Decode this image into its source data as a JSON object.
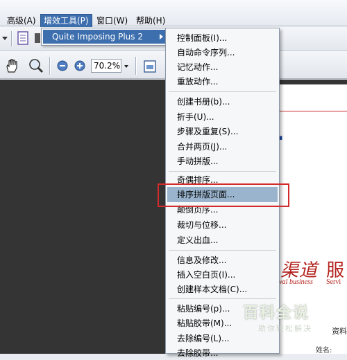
{
  "menubar": {
    "items": [
      {
        "label": "高级(A)"
      },
      {
        "label": "增效工具(P)"
      },
      {
        "label": "窗口(W)"
      },
      {
        "label": "帮助(H)"
      }
    ]
  },
  "toolbar": {
    "zoom_value": "70.2%"
  },
  "submenu1": {
    "label": "Quite Imposing Plus 2"
  },
  "submenu2": {
    "items": [
      {
        "label": "控制面板(I)..."
      },
      {
        "label": "自动命令序列..."
      },
      {
        "label": "记忆动作..."
      },
      {
        "label": "重放动作..."
      },
      {
        "label": "创建书册(b)..."
      },
      {
        "label": "折手(U)..."
      },
      {
        "label": "步骤及重复(S)..."
      },
      {
        "label": "合并两页(J)..."
      },
      {
        "label": "手动拼版..."
      },
      {
        "label": "奇偶排序..."
      },
      {
        "label": "排序拼版页面..."
      },
      {
        "label": "颠倒页序..."
      },
      {
        "label": "裁切与位移..."
      },
      {
        "label": "定义出血..."
      },
      {
        "label": "信息及修改..."
      },
      {
        "label": "插入空白页(I)..."
      },
      {
        "label": "创建样本文档(C)..."
      },
      {
        "label": "粘贴编号(p)..."
      },
      {
        "label": "粘贴胶带(M)..."
      },
      {
        "label": "去除编号(L)..."
      },
      {
        "label": "去除胶带..."
      }
    ],
    "highlighted": "排序拼版页面..."
  },
  "document": {
    "brand_cn_1": "渠道",
    "brand_cn_2": "服",
    "brand_en_1": "wal business",
    "brand_en_2": "Servi",
    "info_label": "资料",
    "name_label": "姓名:"
  },
  "watermark": {
    "title": "百科全说",
    "subtitle": "助你轻松解决"
  }
}
